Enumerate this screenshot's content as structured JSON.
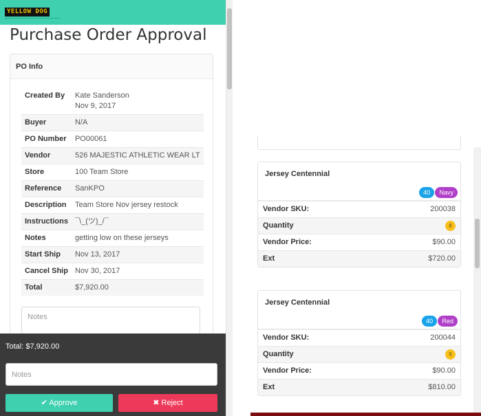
{
  "app": {
    "logo_text": "YELLOW DOG"
  },
  "page": {
    "title": "Purchase Order Approval"
  },
  "po_info": {
    "header": "PO Info",
    "rows": [
      {
        "label": "Created By",
        "value": "Kate Sanderson",
        "value2": "Nov 9, 2017"
      },
      {
        "label": "Buyer",
        "value": "N/A"
      },
      {
        "label": "PO Number",
        "value": "PO00061"
      },
      {
        "label": "Vendor",
        "value": "526 MAJESTIC ATHLETIC WEAR LT"
      },
      {
        "label": "Store",
        "value": "100 Team Store"
      },
      {
        "label": "Reference",
        "value": "SanKPO"
      },
      {
        "label": "Description",
        "value": "Team Store Nov jersey restock"
      },
      {
        "label": "Instructions",
        "value": "¯\\_(ツ)_/¯"
      },
      {
        "label": "Notes",
        "value": "getting low on these jerseys"
      },
      {
        "label": "Start Ship",
        "value": "Nov 13, 2017"
      },
      {
        "label": "Cancel Ship",
        "value": "Nov 30, 2017"
      },
      {
        "label": "Total",
        "value": "$7,920.00"
      }
    ],
    "notes_placeholder": "Notes"
  },
  "footer": {
    "total_text": "Total: $7,920.00",
    "notes_placeholder": "Notes",
    "approve_label": "Approve",
    "reject_label": "Reject"
  },
  "items": [
    {
      "name": "Jersey Centennial",
      "size_badge": "40",
      "color_badge": "Navy",
      "labels": {
        "sku": "Vendor SKU:",
        "qty": "Quantity",
        "price": "Vendor Price:",
        "ext": "Ext"
      },
      "sku": "200038",
      "qty": "8",
      "price": "$90.00",
      "ext": "$720.00"
    },
    {
      "name": "Jersey Centennial",
      "size_badge": "40",
      "color_badge": "Red",
      "labels": {
        "sku": "Vendor SKU:",
        "qty": "Quantity",
        "price": "Vendor Price:",
        "ext": "Ext"
      },
      "sku": "200044",
      "qty": "9",
      "price": "$90.00",
      "ext": "$810.00"
    }
  ],
  "colors": {
    "accent": "#3fd0b0",
    "reject": "#ee3a5a",
    "badge_size": "#1aa3e8",
    "badge_color": "#b040c8",
    "qty": "#f7c01c"
  }
}
